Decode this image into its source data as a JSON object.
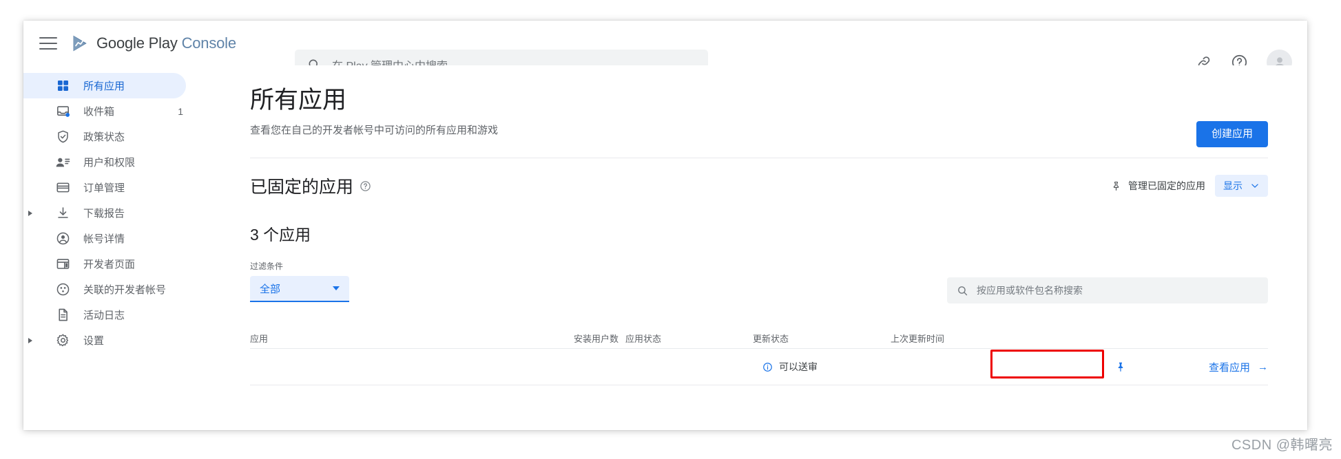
{
  "window": {
    "brand_primary": "Google Play",
    "brand_secondary": "Console",
    "menu_icon": "hamburger-icon"
  },
  "search": {
    "placeholder": "在 Play 管理中心内搜索",
    "value": ""
  },
  "header_actions": {
    "link_icon": "link-icon",
    "help_icon": "help-circle-icon",
    "avatar": "account-avatar"
  },
  "sidebar": {
    "items": [
      {
        "label": "所有应用",
        "icon": "grid-apps-icon",
        "active": true,
        "badge": "",
        "expander": false
      },
      {
        "label": "收件箱",
        "icon": "inbox-icon",
        "active": false,
        "badge": "1",
        "expander": false
      },
      {
        "label": "政策状态",
        "icon": "shield-check-icon",
        "active": false,
        "badge": "",
        "expander": false
      },
      {
        "label": "用户和权限",
        "icon": "users-permissions-icon",
        "active": false,
        "badge": "",
        "expander": false
      },
      {
        "label": "订单管理",
        "icon": "credit-card-icon",
        "active": false,
        "badge": "",
        "expander": false
      },
      {
        "label": "下载报告",
        "icon": "download-icon",
        "active": false,
        "badge": "",
        "expander": true
      },
      {
        "label": "帐号详情",
        "icon": "account-circle-icon",
        "active": false,
        "badge": "",
        "expander": false
      },
      {
        "label": "开发者页面",
        "icon": "developer-page-icon",
        "active": false,
        "badge": "",
        "expander": false
      },
      {
        "label": "关联的开发者帐号",
        "icon": "linked-accounts-icon",
        "active": false,
        "badge": "",
        "expander": false
      },
      {
        "label": "活动日志",
        "icon": "document-icon",
        "active": false,
        "badge": "",
        "expander": false
      },
      {
        "label": "设置",
        "icon": "gear-icon",
        "active": false,
        "badge": "",
        "expander": true
      }
    ]
  },
  "main": {
    "title": "所有应用",
    "subtitle": "查看您在自己的开发者帐号中可访问的所有应用和游戏",
    "create_button": "创建应用",
    "pinned": {
      "title": "已固定的应用",
      "help_icon": "help-circle-icon",
      "manage_label": "管理已固定的应用",
      "pin_icon": "pin-icon",
      "show_label": "显示"
    },
    "count_title": "3 个应用",
    "filter": {
      "label": "过滤条件",
      "value": "全部"
    },
    "app_search": {
      "placeholder": "按应用或软件包名称搜索",
      "value": ""
    },
    "table": {
      "columns": [
        "应用",
        "安装用户数",
        "应用状态",
        "更新状态",
        "上次更新时间"
      ],
      "rows": [
        {
          "app": "",
          "installs": "",
          "app_status": "",
          "update_status": "可以送审",
          "update_status_icon": "info-circle-icon",
          "last_updated": "",
          "pinned": true,
          "view_label": "查看应用",
          "view_arrow": "→",
          "highlighted": true
        }
      ]
    }
  },
  "watermark": "CSDN @韩曙亮",
  "colors": {
    "accent": "#1a73e8",
    "accent_light": "#e8f0fe",
    "text_primary": "#202124",
    "text_secondary": "#5f6368",
    "highlight_box": "#ee0000"
  }
}
